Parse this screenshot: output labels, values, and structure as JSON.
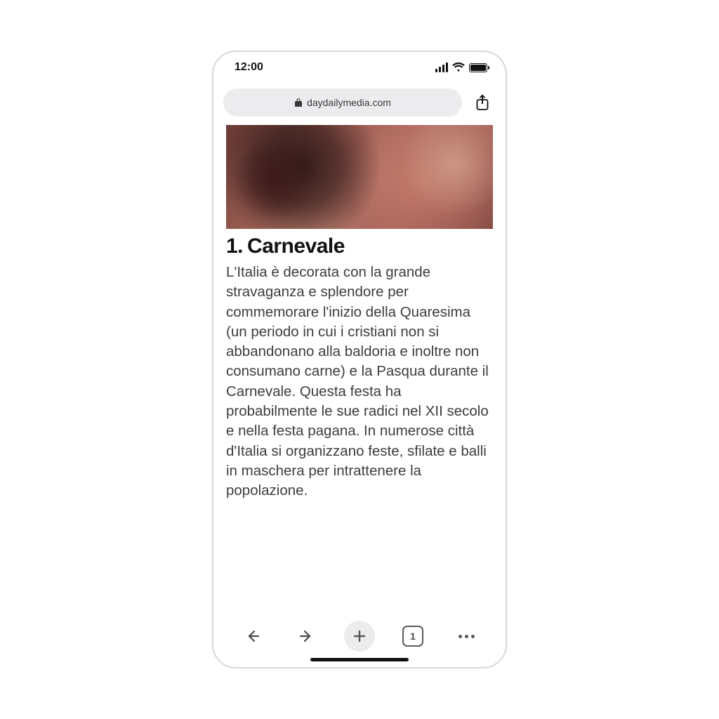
{
  "status": {
    "time": "12:00"
  },
  "browser": {
    "domain": "daydailymedia.com",
    "tab_count": "1"
  },
  "article": {
    "number": "1.",
    "title": "Carnevale",
    "body": "L'Italia è decorata con la grande stravaganza e splendore per commemorare l'inizio della Quaresima (un periodo in cui i cristiani non si abbandonano alla baldoria e inoltre non consumano carne) e la Pasqua durante il Carnevale. Questa festa ha probabilmente le sue radici nel XII secolo e nella festa pagana. In numerose città d'Italia si organizzano feste, sfilate e balli in maschera per intrattenere la popolazione."
  }
}
